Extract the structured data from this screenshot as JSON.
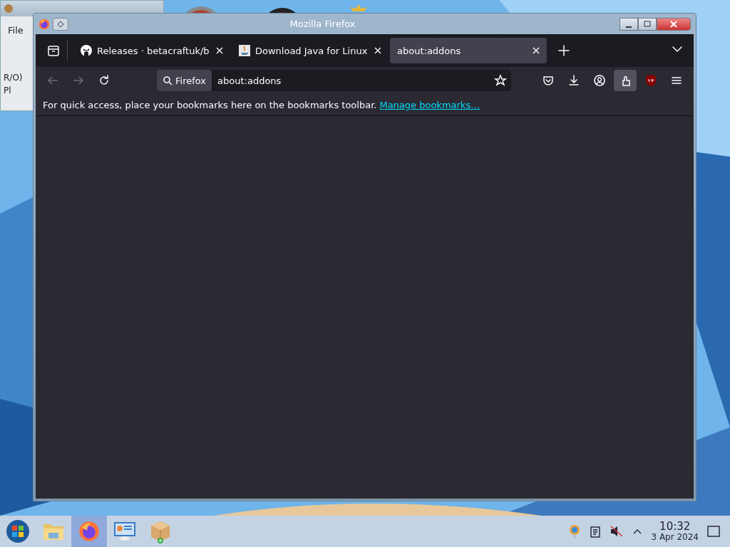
{
  "background_window": {
    "menu": [
      "File"
    ],
    "lines": [
      "R/O)",
      "Pl"
    ]
  },
  "window": {
    "title": "Mozilla Firefox"
  },
  "tabs": [
    {
      "label": "Releases · betacraftuk/b",
      "kind": "github",
      "selected": false
    },
    {
      "label": "Download Java for Linux",
      "kind": "java",
      "selected": false
    },
    {
      "label": "about:addons",
      "kind": "plain",
      "selected": true
    }
  ],
  "url_bar": {
    "engine": "Firefox",
    "value": "about:addons"
  },
  "bookmarks_bar": {
    "message": "For quick access, place your bookmarks here on the bookmarks toolbar.",
    "link": "Manage bookmarks…"
  },
  "taskbar": {
    "apps": [
      {
        "kind": "folder",
        "selected": false
      },
      {
        "kind": "firefox",
        "selected": true
      },
      {
        "kind": "remote",
        "selected": false
      },
      {
        "kind": "package",
        "selected": false
      }
    ],
    "clock": {
      "time": "10:32",
      "date": "3 Apr 2024"
    }
  }
}
